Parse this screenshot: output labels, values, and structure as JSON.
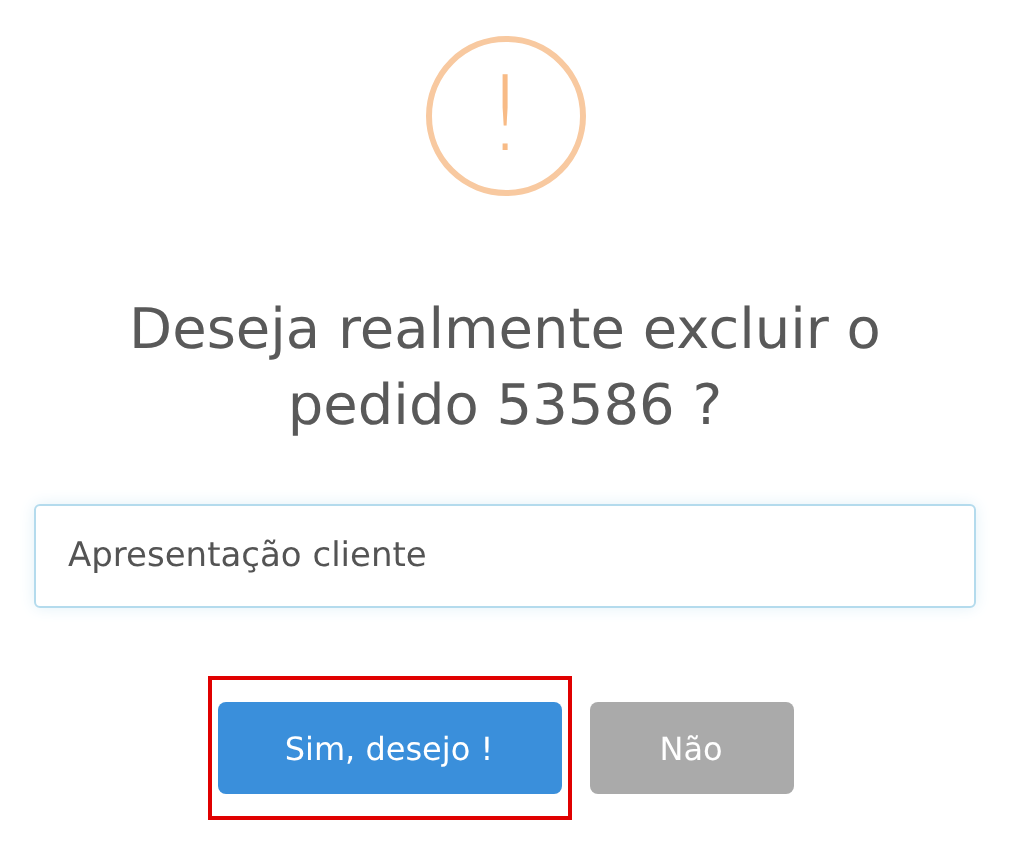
{
  "dialog": {
    "icon": "!",
    "title": "Deseja realmente excluir o pedido 53586 ?",
    "input": {
      "value": "Apresentação cliente"
    },
    "buttons": [
      {
        "label": "Sim, desejo !",
        "kind": "confirm",
        "highlighted": true
      },
      {
        "label": "Não",
        "kind": "cancel",
        "highlighted": false
      }
    ]
  }
}
